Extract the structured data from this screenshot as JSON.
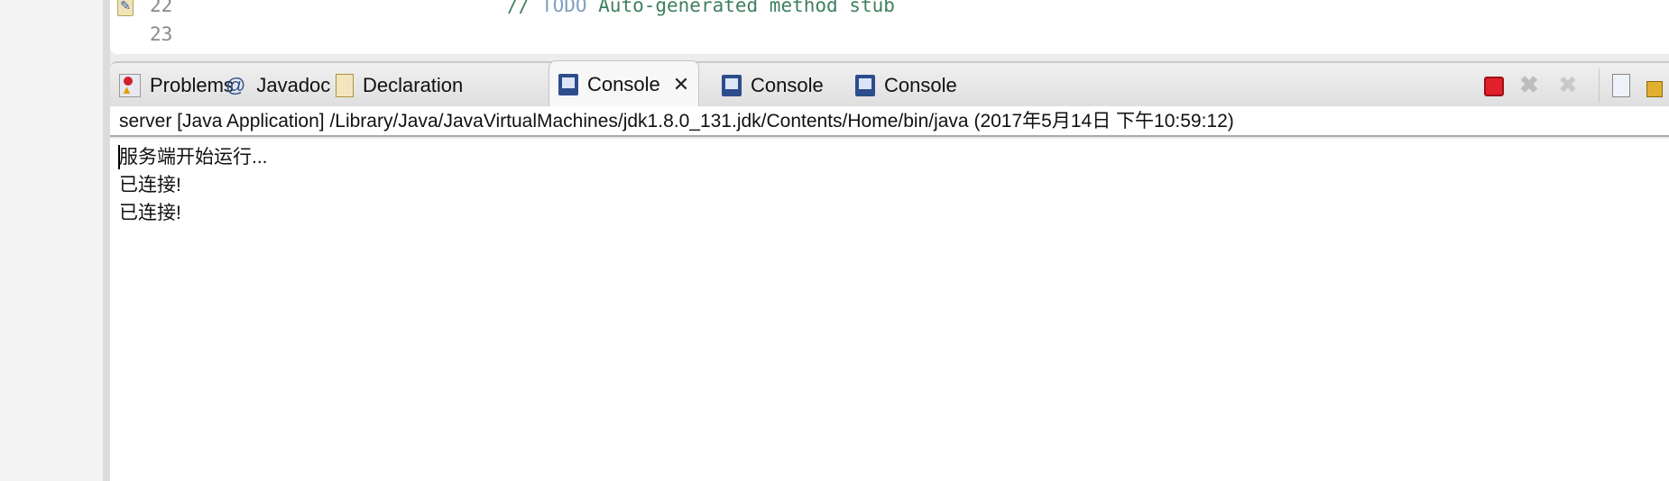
{
  "editor": {
    "lines": [
      {
        "number": "22",
        "comment_prefix": "// ",
        "todo": "TODO",
        "comment": " Auto-generated method stub"
      },
      {
        "number": "23"
      }
    ]
  },
  "tabs": [
    {
      "label": "Problems",
      "icon": "problems-icon"
    },
    {
      "label": "Javadoc",
      "icon": "at-icon",
      "glyph": "@"
    },
    {
      "label": "Declaration",
      "icon": "declaration-icon"
    },
    {
      "label": "Console",
      "icon": "console-icon",
      "active": true,
      "close_glyph": "✕"
    },
    {
      "label": "Console",
      "icon": "console-icon"
    },
    {
      "label": "Console",
      "icon": "console-icon"
    }
  ],
  "toolbar": {
    "terminate_color": "#e0202a"
  },
  "console": {
    "info": "server [Java Application] /Library/Java/JavaVirtualMachines/jdk1.8.0_131.jdk/Contents/Home/bin/java (2017年5月14日 下午10:59:12)",
    "output": [
      "服务端开始运行...",
      "已连接!",
      "已连接!"
    ]
  }
}
